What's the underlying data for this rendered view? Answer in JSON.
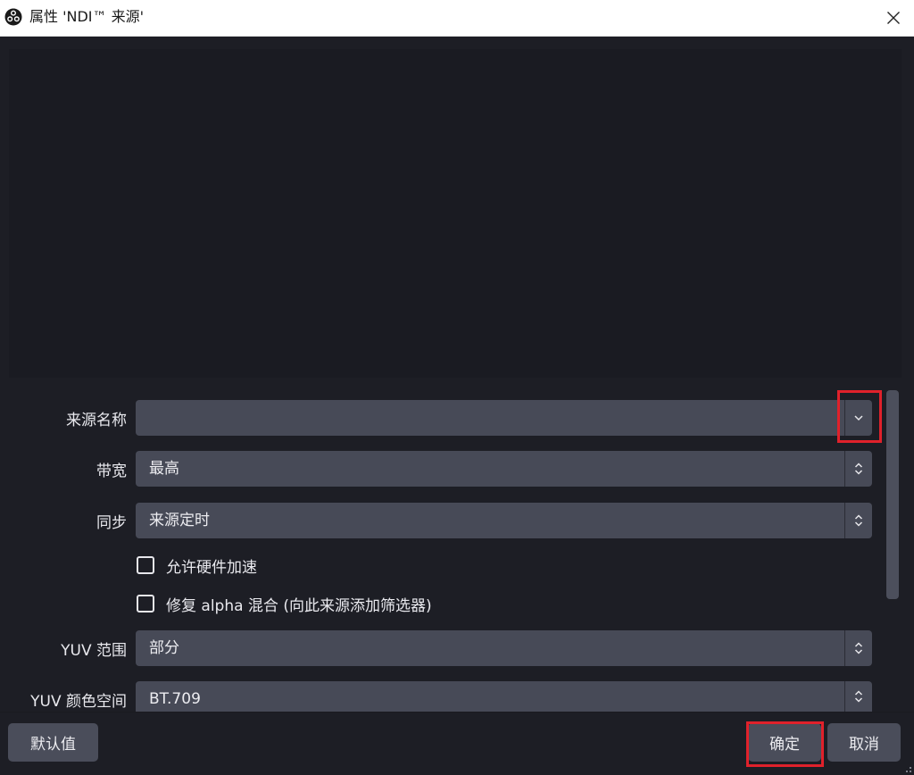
{
  "window": {
    "title": "属性 'NDI™ 来源'"
  },
  "form": {
    "source_name": {
      "label": "来源名称",
      "value": ""
    },
    "bandwidth": {
      "label": "带宽",
      "value": "最高"
    },
    "sync": {
      "label": "同步",
      "value": "来源定时"
    },
    "hw_accel": {
      "label": "允许硬件加速",
      "checked": false
    },
    "alpha_fix": {
      "label": "修复 alpha 混合 (向此来源添加筛选器)",
      "checked": false
    },
    "yuv_range": {
      "label": "YUV 范围",
      "value": "部分"
    },
    "yuv_colorspace": {
      "label": "YUV 颜色空间",
      "value": "BT.709"
    }
  },
  "footer": {
    "defaults_label": "默认值",
    "ok_label": "确定",
    "cancel_label": "取消"
  },
  "colors": {
    "background": "#1d1e25",
    "control": "#474a57",
    "highlight": "#e0212b"
  },
  "icons": [
    "obs-logo-icon",
    "close-icon",
    "chevron-down-icon",
    "updown-arrows-icon",
    "resize-grip-icon"
  ]
}
